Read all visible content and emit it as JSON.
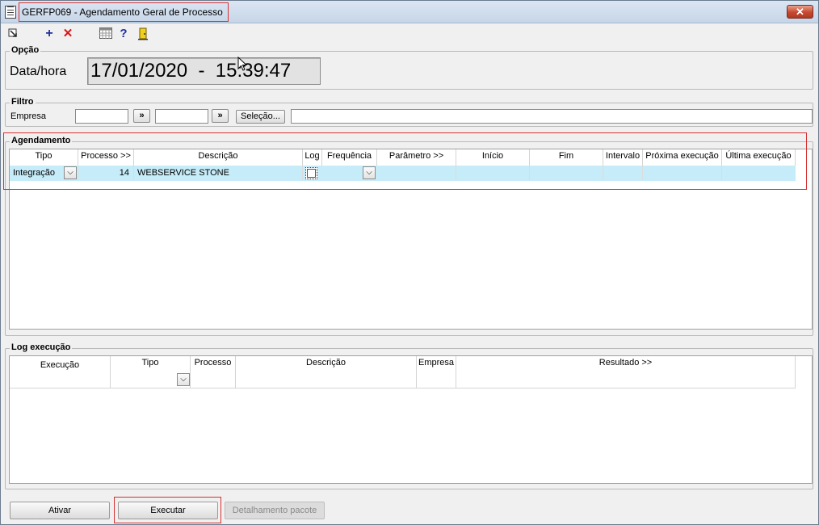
{
  "window": {
    "title": "GERFP069 - Agendamento Geral de Processo",
    "close_label": "✕"
  },
  "opcao": {
    "legend": "Opção",
    "datetime_label": "Data/hora",
    "datetime_value": "17/01/2020  -  15:39:47"
  },
  "filtro": {
    "legend": "Filtro",
    "empresa_label": "Empresa",
    "arrow_label": "»",
    "selecao_label": "Seleção..."
  },
  "agendamento": {
    "legend": "Agendamento",
    "columns": [
      "Tipo",
      "Processo >>",
      "Descrição",
      "Log",
      "Frequência",
      "Parâmetro >>",
      "Início",
      "Fim",
      "Intervalo",
      "Próxima execução",
      "Última execução"
    ],
    "row": {
      "tipo": "Integração",
      "processo": "14",
      "descricao": "WEBSERVICE STONE"
    }
  },
  "log": {
    "legend": "Log execução",
    "columns": [
      "Execução",
      "Tipo",
      "Processo",
      "Descrição",
      "Empresa",
      "Resultado >>"
    ]
  },
  "buttons": {
    "ativar": "Ativar",
    "executar": "Executar",
    "detalhamento": "Detalhamento pacote"
  },
  "colors": {
    "selection": "#c5ecf8",
    "highlight": "#d63030"
  }
}
